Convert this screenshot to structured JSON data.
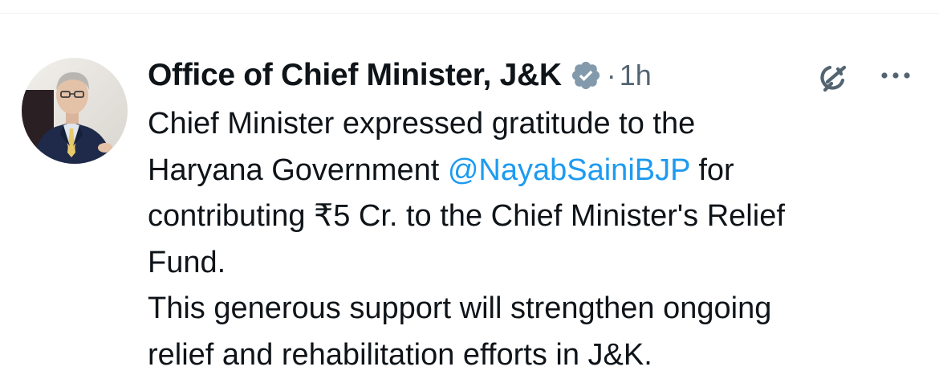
{
  "tweet": {
    "author_name": "Office of Chief Minister, J&K",
    "dot_separator": "·",
    "timestamp": "1h",
    "text_lines": [
      {
        "before": "Chief Minister expressed gratitude to the"
      },
      {
        "before": "Haryana Government ",
        "mention": "@NayabSainiBJP",
        "after": " for"
      },
      {
        "before": "contributing ₹5 Cr. to the Chief Minister's Relief"
      },
      {
        "before": "Fund."
      },
      {
        "before": "This generous support will strengthen ongoing"
      },
      {
        "before": "relief and rehabilitation efforts in J&K."
      }
    ]
  },
  "icons": {
    "verified": "verified-badge-icon",
    "grok": "grok-icon",
    "more": "more-options-icon"
  },
  "colors": {
    "text": "#0f1419",
    "secondary_text": "#536471",
    "mention": "#1d9bf0",
    "verified_badge": "#829aab",
    "background": "#ffffff"
  }
}
